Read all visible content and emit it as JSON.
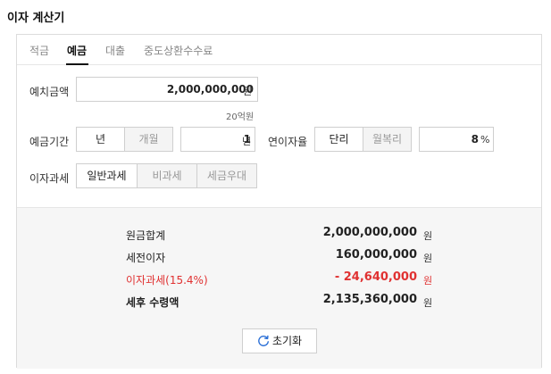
{
  "page": {
    "title": "이자 계산기"
  },
  "tabs": [
    {
      "label": "적금"
    },
    {
      "label": "예금"
    },
    {
      "label": "대출"
    },
    {
      "label": "중도상환수수료"
    }
  ],
  "form": {
    "deposit": {
      "label": "예치금액",
      "value": "2,000,000,000",
      "unit": "원",
      "hint": "20억원"
    },
    "period": {
      "label": "예금기간",
      "options": [
        "년",
        "개월"
      ],
      "value": "1",
      "unit": "년"
    },
    "rate": {
      "label": "연이자율",
      "options": [
        "단리",
        "월복리"
      ],
      "value": "8",
      "unit": "%"
    },
    "tax": {
      "label": "이자과세",
      "options": [
        "일반과세",
        "비과세",
        "세금우대"
      ]
    }
  },
  "result": {
    "unit": "원",
    "rows": [
      {
        "label": "원금합계",
        "value": "2,000,000,000"
      },
      {
        "label": "세전이자",
        "value": "160,000,000"
      },
      {
        "label": "이자과세(15.4%)",
        "value": "- 24,640,000"
      },
      {
        "label": "세후 수령액",
        "value": "2,135,360,000"
      }
    ],
    "reset_label": "초기화"
  },
  "colors": {
    "accent_red": "#e03131",
    "border": "#cfcfcf"
  },
  "icons": {
    "reset": "refresh-icon"
  }
}
